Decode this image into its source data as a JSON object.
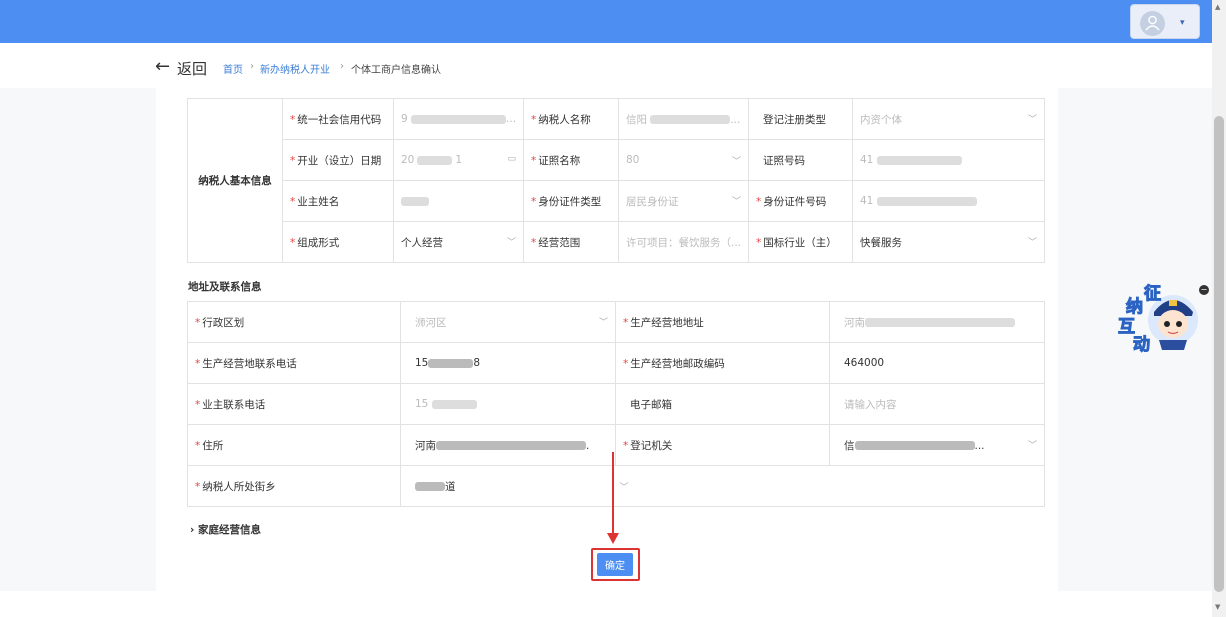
{
  "header": {
    "avatar_icon": "user-icon",
    "caret": "▾"
  },
  "subheader": {
    "back_arrow": "←",
    "back_label": "返回",
    "breadcrumb": [
      "首页",
      "新办纳税人开业",
      "个体工商户信息确认"
    ],
    "separator": "›"
  },
  "basic_info": {
    "group_label": "纳税人基本信息",
    "rows": [
      [
        {
          "label": "统一社会信用代码",
          "required": true,
          "value": "9",
          "suffix": "..."
        },
        {
          "label": "纳税人名称",
          "required": true,
          "value": "信阳",
          "suffix": "..."
        },
        {
          "label": "登记注册类型",
          "required": false,
          "value": "内资个体",
          "dropdown": true
        }
      ],
      [
        {
          "label": "开业（设立）日期",
          "required": true,
          "value": "20",
          "suffix": "1",
          "calendar": true
        },
        {
          "label": "证照名称",
          "required": true,
          "value": "80",
          "dropdown": true
        },
        {
          "label": "证照号码",
          "required": false,
          "value": "41"
        }
      ],
      [
        {
          "label": "业主姓名",
          "required": true,
          "value": ""
        },
        {
          "label": "身份证件类型",
          "required": true,
          "value": "居民身份证",
          "dropdown": true
        },
        {
          "label": "身份证件号码",
          "required": true,
          "value": "41"
        }
      ],
      [
        {
          "label": "组成形式",
          "required": true,
          "value": "个人经营",
          "dropdown": true,
          "dark": true
        },
        {
          "label": "经营范围",
          "required": true,
          "value": "许可项目：餐饮服务（..."
        },
        {
          "label": "国标行业（主）",
          "required": true,
          "value": "快餐服务",
          "dropdown": true,
          "dark": true
        }
      ]
    ]
  },
  "address": {
    "title": "地址及联系信息",
    "rows": [
      [
        {
          "label": "行政区划",
          "required": true,
          "value": "浉河区",
          "dropdown": true
        },
        {
          "label": "生产经营地地址",
          "required": true,
          "value": "河南"
        }
      ],
      [
        {
          "label": "生产经营地联系电话",
          "required": true,
          "value": "15",
          "suffix": "8",
          "dark": true
        },
        {
          "label": "生产经营地邮政编码",
          "required": true,
          "value": "464000",
          "dark": true
        }
      ],
      [
        {
          "label": "业主联系电话",
          "required": true,
          "value": "15"
        },
        {
          "label": "电子邮箱",
          "required": false,
          "value": "",
          "placeholder": "请输入内容"
        }
      ],
      [
        {
          "label": "住所",
          "required": true,
          "value": "河南",
          "suffix": ".",
          "dark": true
        },
        {
          "label": "登记机关",
          "required": true,
          "value": "信",
          "suffix": "...",
          "dropdown": true,
          "dark": true
        }
      ],
      [
        {
          "label": "纳税人所处街乡",
          "required": true,
          "value": "道",
          "dropdown": true,
          "dark": true
        }
      ]
    ]
  },
  "family": {
    "label": "家庭经营信息",
    "chevron": "›"
  },
  "confirm_label": "确定",
  "mascot": {
    "chars": [
      "征",
      "纳",
      "互",
      "动"
    ],
    "close": "−",
    "icon": "tax-officer-mascot-icon"
  },
  "icons": {
    "dropdown": "chevron-down-icon",
    "calendar": "calendar-icon"
  },
  "colors": {
    "topbar": "#4d8ef2",
    "required": "#e34545",
    "link": "#3b7ed6",
    "highlight": "#dd3333"
  }
}
